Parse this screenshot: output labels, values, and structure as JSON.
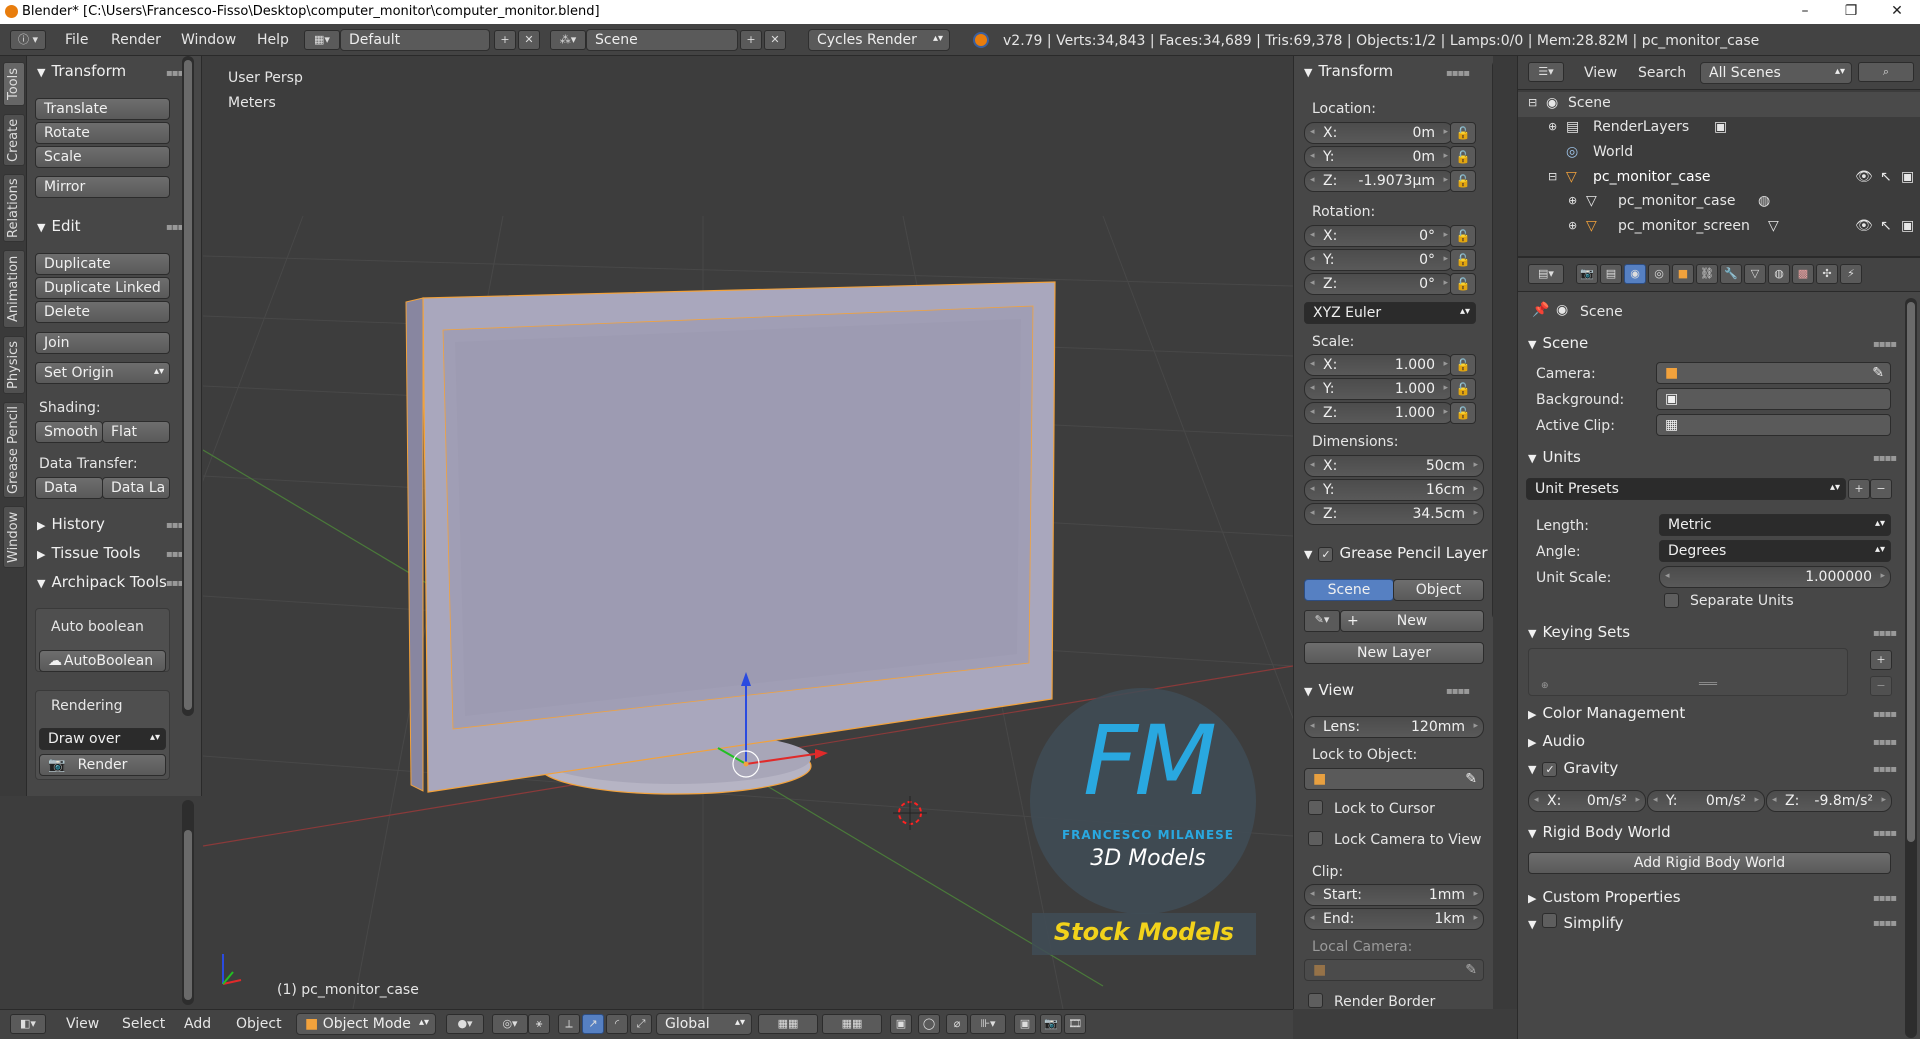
{
  "window": {
    "title": "Blender* [C:\\Users\\Francesco-Fisso\\Desktop\\computer_monitor\\computer_monitor.blend]",
    "minimize": "–",
    "maximize": "❐",
    "close": "✕"
  },
  "info_header": {
    "menus": [
      "File",
      "Render",
      "Window",
      "Help"
    ],
    "screen_layout": "Default",
    "scene": "Scene",
    "render_engine": "Cycles Render",
    "stats": "v2.79 | Verts:34,843 | Faces:34,689 | Tris:69,378 | Objects:1/2 | Lamps:0/0 | Mem:28.82M | pc_monitor_case"
  },
  "tool_tabs": [
    "Tools",
    "Create",
    "Relations",
    "Animation",
    "Physics",
    "Grease Pencil",
    "Window"
  ],
  "tool_shelf": {
    "transform": {
      "title": "Transform",
      "buttons": [
        "Translate",
        "Rotate",
        "Scale",
        "Mirror"
      ]
    },
    "edit": {
      "title": "Edit",
      "buttons": [
        "Duplicate",
        "Duplicate Linked",
        "Delete",
        "Join"
      ],
      "set_origin": "Set Origin",
      "shading_label": "Shading:",
      "smooth": "Smooth",
      "flat": "Flat",
      "data_transfer_label": "Data Transfer:",
      "data": "Data",
      "data_la": "Data La"
    },
    "history": "History",
    "tissue": "Tissue Tools",
    "archipack": {
      "title": "Archipack Tools",
      "auto_boolean_label": "Auto boolean",
      "auto_boolean_btn": "AutoBoolean",
      "rendering_label": "Rendering",
      "draw_over": "Draw over",
      "render_btn": "Render"
    }
  },
  "viewport": {
    "view_name": "User Persp",
    "units": "Meters",
    "object_label": "(1) pc_monitor_case",
    "watermark_letters": "FM",
    "watermark_name": "FRANCESCO MILANESE",
    "watermark_sub": "3D Models",
    "watermark_stock": "Stock Models"
  },
  "n_panel": {
    "transform_title": "Transform",
    "location_label": "Location:",
    "location": [
      {
        "axis": "X:",
        "value": "0m"
      },
      {
        "axis": "Y:",
        "value": "0m"
      },
      {
        "axis": "Z:",
        "value": "-1.9073µm"
      }
    ],
    "rotation_label": "Rotation:",
    "rotation": [
      {
        "axis": "X:",
        "value": "0°"
      },
      {
        "axis": "Y:",
        "value": "0°"
      },
      {
        "axis": "Z:",
        "value": "0°"
      }
    ],
    "rotation_mode": "XYZ Euler",
    "scale_label": "Scale:",
    "scale": [
      {
        "axis": "X:",
        "value": "1.000"
      },
      {
        "axis": "Y:",
        "value": "1.000"
      },
      {
        "axis": "Z:",
        "value": "1.000"
      }
    ],
    "dimensions_label": "Dimensions:",
    "dimensions": [
      {
        "axis": "X:",
        "value": "50cm"
      },
      {
        "axis": "Y:",
        "value": "16cm"
      },
      {
        "axis": "Z:",
        "value": "34.5cm"
      }
    ],
    "gp_title": "Grease Pencil Layer",
    "gp_scene": "Scene",
    "gp_object": "Object",
    "gp_new": "New",
    "gp_new_layer": "New Layer",
    "view_title": "View",
    "lens_label": "Lens:",
    "lens_value": "120mm",
    "lock_to_object": "Lock to Object:",
    "lock_to_cursor": "Lock to Cursor",
    "lock_camera": "Lock Camera to View",
    "clip_label": "Clip:",
    "clip_start_label": "Start:",
    "clip_start": "1mm",
    "clip_end_label": "End:",
    "clip_end": "1km",
    "local_camera": "Local Camera:",
    "render_border": "Render Border"
  },
  "outliner": {
    "view": "View",
    "search": "Search",
    "filter": "All Scenes",
    "rows": [
      {
        "label": "Scene"
      },
      {
        "label": "RenderLayers"
      },
      {
        "label": "World"
      },
      {
        "label": "pc_monitor_case"
      },
      {
        "label": "pc_monitor_case"
      },
      {
        "label": "pc_monitor_screen"
      }
    ]
  },
  "properties": {
    "context": "Scene",
    "scene_title": "Scene",
    "camera_label": "Camera:",
    "background_label": "Background:",
    "active_clip_label": "Active Clip:",
    "units_title": "Units",
    "unit_presets": "Unit Presets",
    "length_label": "Length:",
    "length_value": "Metric",
    "angle_label": "Angle:",
    "angle_value": "Degrees",
    "unit_scale_label": "Unit Scale:",
    "unit_scale_value": "1.000000",
    "separate_units": "Separate Units",
    "keying_sets": "Keying Sets",
    "color_management": "Color Management",
    "audio": "Audio",
    "gravity": "Gravity",
    "gravity_values": [
      {
        "axis": "X:",
        "value": "0m/s²"
      },
      {
        "axis": "Y:",
        "value": "0m/s²"
      },
      {
        "axis": "Z:",
        "value": "-9.8m/s²"
      }
    ],
    "rigid_body_world": "Rigid Body World",
    "add_rigid_body_world": "Add Rigid Body World",
    "custom_properties": "Custom Properties",
    "simplify": "Simplify"
  },
  "bottom_bar": {
    "menus": [
      "View",
      "Select",
      "Add",
      "Object"
    ],
    "mode": "Object Mode",
    "orientation": "Global"
  },
  "colors": {
    "accent_blue": "#5680c2",
    "selection_orange": "#f2a23c",
    "watermark_blue": "#29a8e0",
    "watermark_yellow": "#f2d21b"
  }
}
